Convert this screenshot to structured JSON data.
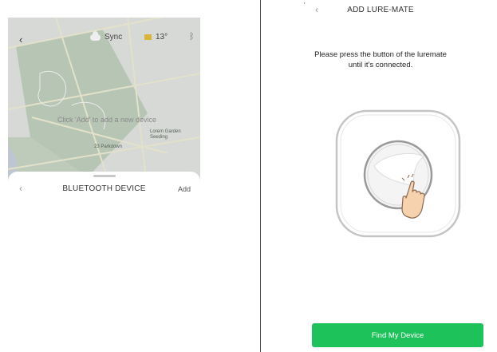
{
  "left_screen": {
    "map": {
      "back_icon": "chevron-left-icon",
      "sync_label": "Sync",
      "temperature": "13°",
      "bluetooth_icon": "bluetooth-icon",
      "labels": [
        "23 Parkdown",
        "Lorem Garden Seeding"
      ]
    },
    "sheet": {
      "back_icon": "chevron-left-icon",
      "title": "BLUETOOTH DEVICE",
      "add_label": "Add",
      "empty_message": "Click 'Add' to add a new device"
    }
  },
  "right_screen": {
    "mark": "'",
    "back_icon": "chevron-left-icon",
    "title": "ADD LURE-MATE",
    "instruction_line1": "Please press the button of the luremate",
    "instruction_line2": "until it's connected.",
    "device_icon": "luremate-device-icon",
    "hand_icon": "hand-pointer-icon",
    "button_label": "Find My Device",
    "colors": {
      "accent": "#1ec25a",
      "divider": "#4a4a4a"
    }
  }
}
